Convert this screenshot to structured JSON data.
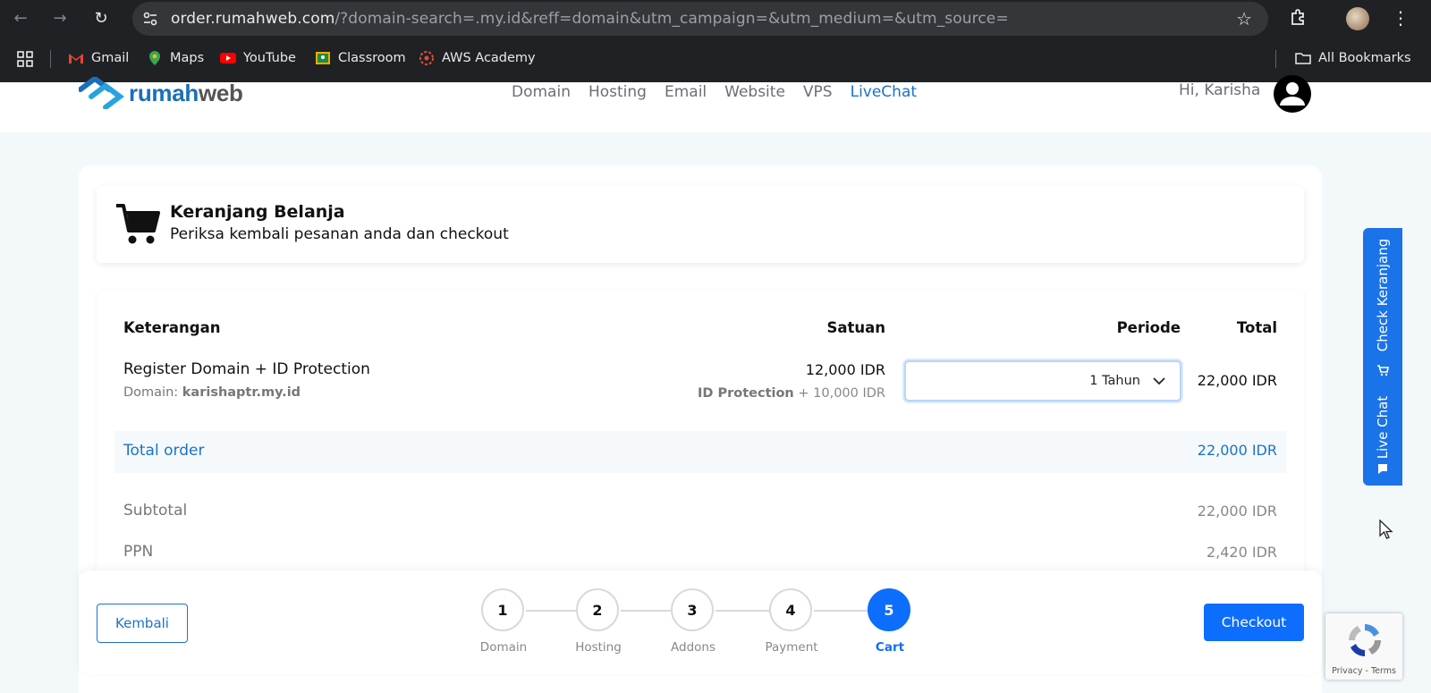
{
  "browser": {
    "url_host": "order.rumahweb.com",
    "url_rest": "/?domain-search=.my.id&reff=domain&utm_campaign=&utm_medium=&utm_source=",
    "bookmarks": [
      {
        "label": "Gmail",
        "icon": "gmail-icon",
        "color": "#ea4335"
      },
      {
        "label": "Maps",
        "icon": "maps-icon",
        "color": "#34a853"
      },
      {
        "label": "YouTube",
        "icon": "youtube-icon",
        "color": "#ff0000"
      },
      {
        "label": "Classroom",
        "icon": "classroom-icon",
        "color": "#f9ab00"
      },
      {
        "label": "AWS Academy",
        "icon": "aws-academy-icon",
        "color": "#e74c3c"
      }
    ],
    "all_bookmarks": "All Bookmarks"
  },
  "header": {
    "logo_prefix": "rumah",
    "logo_suffix": "web",
    "nav": [
      "Domain",
      "Hosting",
      "Email",
      "Website",
      "VPS",
      "LiveChat"
    ],
    "greeting": "Hi, Karisha"
  },
  "cart": {
    "title": "Keranjang Belanja",
    "subtitle": "Periksa kembali pesanan anda dan checkout",
    "columns": {
      "desc": "Keterangan",
      "unit": "Satuan",
      "period": "Periode",
      "total": "Total"
    },
    "item": {
      "name": "Register Domain + ID Protection",
      "domain_label": "Domain:",
      "domain_value": "karishaptr.my.id",
      "unit_price": "12,000 IDR",
      "addon_label": "ID Protection",
      "addon_price": "+ 10,000 IDR",
      "period": "1 Tahun",
      "total": "22,000 IDR"
    },
    "total_order_label": "Total order",
    "total_order_value": "22,000 IDR",
    "subtotal_label": "Subtotal",
    "subtotal_value": "22,000 IDR",
    "ppn_label": "PPN",
    "ppn_value": "2,420 IDR"
  },
  "footer": {
    "back_label": "Kembali",
    "checkout_label": "Checkout",
    "steps": [
      {
        "num": "1",
        "label": "Domain"
      },
      {
        "num": "2",
        "label": "Hosting"
      },
      {
        "num": "3",
        "label": "Addons"
      },
      {
        "num": "4",
        "label": "Payment"
      },
      {
        "num": "5",
        "label": "Cart"
      }
    ],
    "current_step": 5
  },
  "side_tab": {
    "check_cart": "Check Keranjang",
    "live_chat": "Live Chat"
  },
  "recaptcha": {
    "text": "Privacy - Terms"
  },
  "colors": {
    "accent": "#1a73c9",
    "primary_button": "#0d6efd",
    "side_tab": "#1a73e8"
  }
}
